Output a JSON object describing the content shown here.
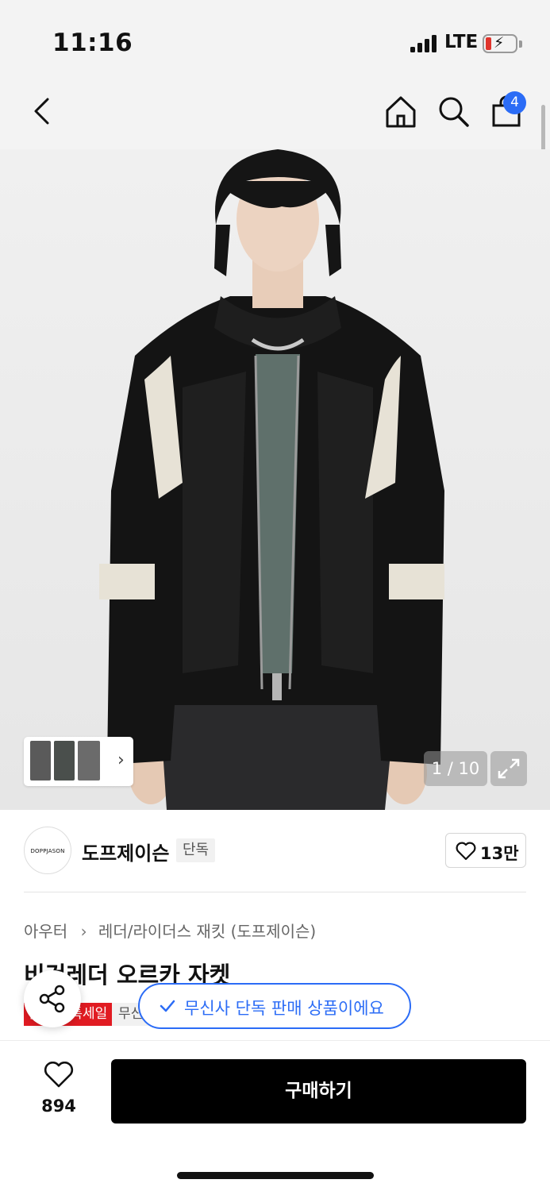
{
  "status_bar": {
    "time": "11:16",
    "network": "LTE",
    "battery_level": 0.2,
    "battery_color": "#e0342c"
  },
  "header": {
    "back_icon": "chevron-left-icon",
    "home_icon": "home-icon",
    "search_icon": "search-icon",
    "cart_icon": "shopping-bag-icon",
    "cart_count": "4",
    "badge_color": "#2b6cf6"
  },
  "gallery": {
    "counter": "1 / 10",
    "current_index": 1,
    "total": 10,
    "thumbnails_count": 3,
    "thumb_more_icon": "chevron-right-icon",
    "expand_icon": "expand-icon"
  },
  "brand": {
    "logo_text": "DOPPJASON",
    "name": "도프제이슨",
    "exclusive_tag": "단독",
    "like_count": "13만",
    "like_icon": "heart-outline-icon"
  },
  "product": {
    "breadcrumb": [
      "아우터",
      "레더/라이더스 재킷 (도프제이슨)"
    ],
    "title": "비건레더 오르카 자켓",
    "sale_tag": "올인원 특세일",
    "musinsa_tag": "무신사"
  },
  "overlay": {
    "share_icon": "share-icon",
    "toast_text": "무신사 단독 판매 상품이에요",
    "toast_icon": "check-icon",
    "accent_color": "#2b6cf6"
  },
  "bottom_bar": {
    "wish_icon": "heart-outline-icon",
    "wish_count": "894",
    "buy_label": "구매하기"
  }
}
